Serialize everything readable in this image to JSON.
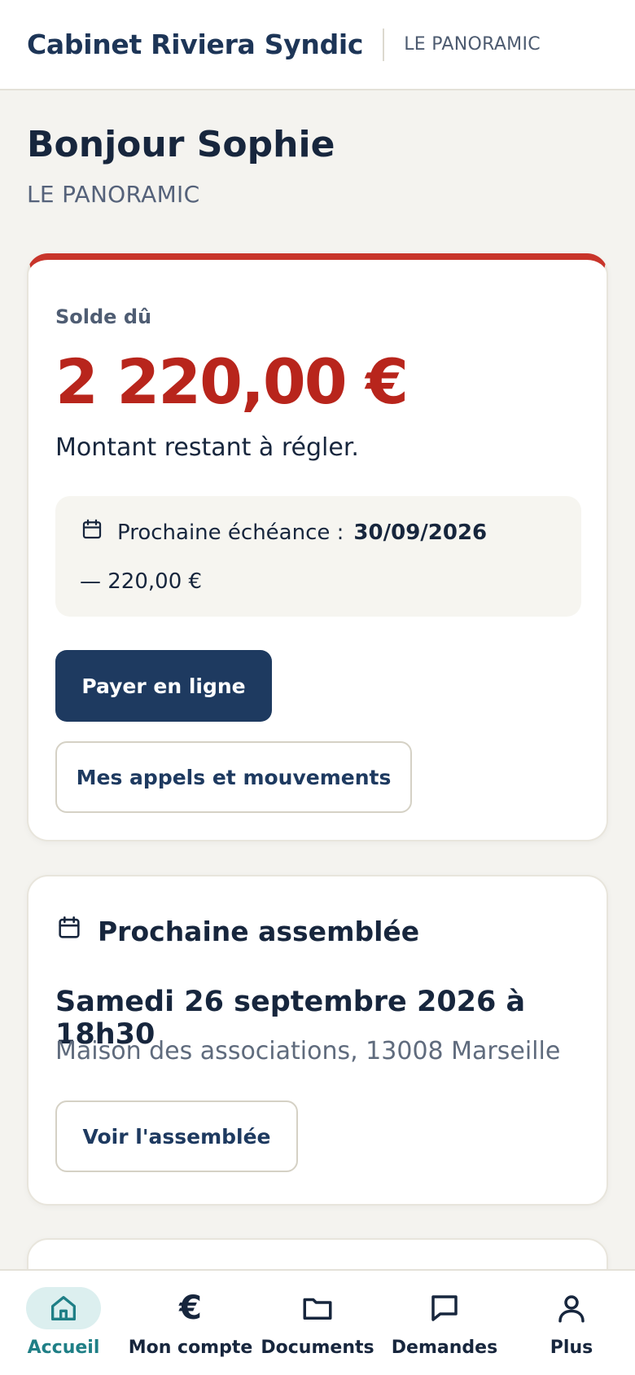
{
  "header": {
    "brand": "Cabinet Riviera Syndic",
    "residence": "LE PANORAMIC"
  },
  "greeting": {
    "title": "Bonjour Sophie",
    "subtitle": "LE PANORAMIC"
  },
  "balance": {
    "label": "Solde dû",
    "amount": "2 220,00 €",
    "note": "Montant restant à régler.",
    "due_label": "Prochaine échéance :",
    "due_date": "30/09/2026",
    "due_amount": "— 220,00 €",
    "pay_button": "Payer en ligne",
    "movements_button": "Mes appels et mouvements",
    "accent_color": "#c8342a"
  },
  "assembly": {
    "title": "Prochaine assemblée",
    "date": "Samedi 26 septembre 2026 à 18h30",
    "place": "Maison des associations, 13008 Marseille",
    "button": "Voir l'assemblée"
  },
  "nav": {
    "items": [
      {
        "label": "Accueil",
        "icon": "home-icon",
        "active": true
      },
      {
        "label": "Mon compte",
        "icon": "euro-icon",
        "active": false
      },
      {
        "label": "Documents",
        "icon": "folder-icon",
        "active": false
      },
      {
        "label": "Demandes",
        "icon": "chat-bubble-icon",
        "active": false
      },
      {
        "label": "Plus",
        "icon": "user-icon",
        "active": false
      }
    ],
    "active_color": "#1f7f86"
  }
}
